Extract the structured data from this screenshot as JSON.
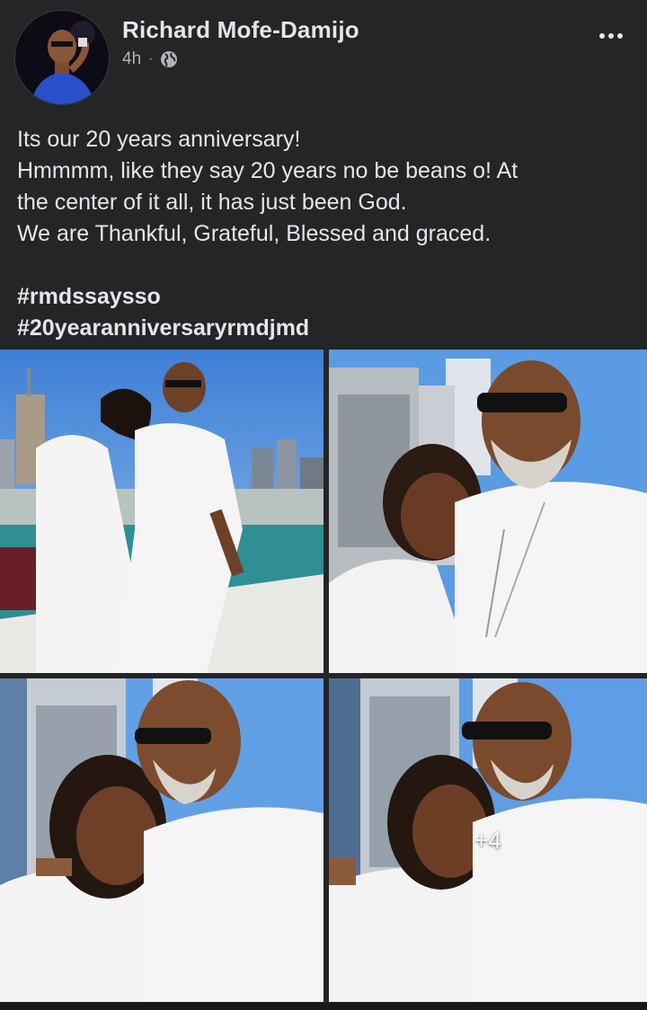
{
  "post": {
    "author": "Richard Mofe-Damijo",
    "time": "4h",
    "separator": "·",
    "privacy_icon": "globe-icon",
    "more_icon": "more-options-icon",
    "text_lines": [
      "Its our 20 years anniversary!",
      "Hmmmm, like they say 20 years no be beans o! At",
      "the center of it all, it has  just been God.",
      "We are Thankful, Grateful, Blessed and graced."
    ],
    "hashtags": [
      "#rmdssaysso",
      "#20yearanniversaryrmdjmd"
    ]
  },
  "photos": {
    "more_count_label": "+4"
  },
  "colors": {
    "background": "#242526",
    "text": "#e4e6eb",
    "secondary_text": "#b0b3b8"
  }
}
